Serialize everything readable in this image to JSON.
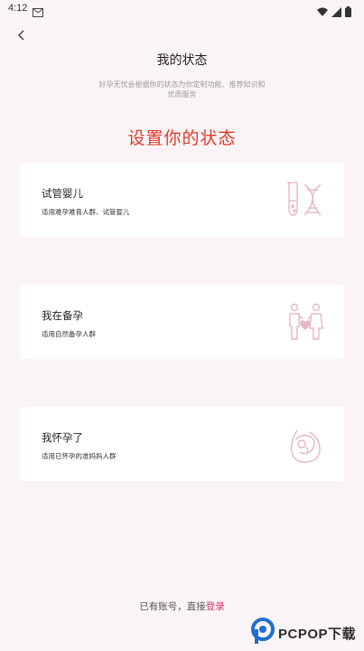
{
  "status_bar": {
    "time": "4:12"
  },
  "header": {
    "title": "我的状态",
    "subtitle": "好孕无忧会根据你的状态为你定制功能、推荐知识和优质服务"
  },
  "main": {
    "heading": "设置你的状态",
    "options": [
      {
        "title": "试管婴儿",
        "desc": "适用难孕难育人群、试管婴儿",
        "icon": "test-tube-dna-icon"
      },
      {
        "title": "我在备孕",
        "desc": "适用自然备孕人群",
        "icon": "couple-heart-icon"
      },
      {
        "title": "我怀孕了",
        "desc": "适用已怀孕的准妈妈人群",
        "icon": "pregnant-belly-icon"
      }
    ]
  },
  "footer": {
    "prompt": "已有账号，直接",
    "login_label": "登录"
  },
  "watermark": {
    "brand": "PCPOP下载"
  },
  "colors": {
    "background": "#fbf4f6",
    "accent_red": "#e0392b",
    "link_pink": "#d13a68",
    "icon_pink": "#e5b7c3"
  }
}
